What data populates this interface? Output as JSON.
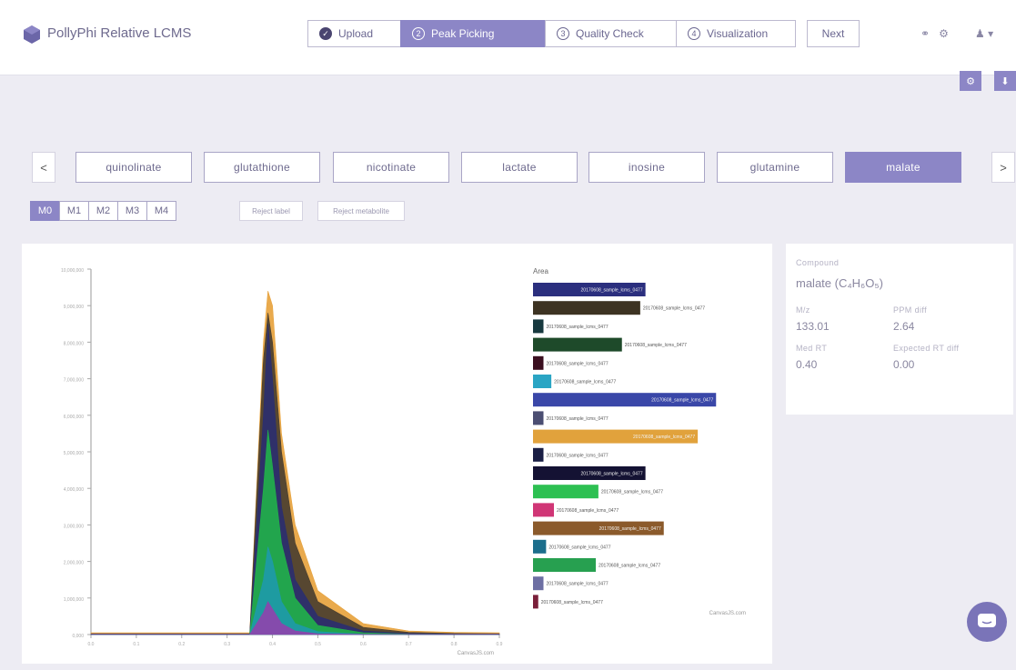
{
  "header": {
    "title": "PollyPhi Relative LCMS",
    "steps": [
      {
        "label": "Upload",
        "marker": "✓"
      },
      {
        "label": "Peak Picking",
        "marker": "2"
      },
      {
        "label": "Quality Check",
        "marker": "3"
      },
      {
        "label": "Visualization",
        "marker": "4"
      }
    ],
    "next_label": "Next",
    "icons": [
      "link-icon",
      "settings-icon",
      "user-icon"
    ]
  },
  "toolbar": {
    "icons": [
      "settings-icon",
      "download-icon"
    ]
  },
  "metabolites": {
    "prev": "<",
    "next": ">",
    "items": [
      "quinolinate",
      "glutathione",
      "nicotinate",
      "lactate",
      "inosine",
      "glutamine",
      "malate"
    ],
    "active": "malate"
  },
  "isotopes": {
    "items": [
      "M0",
      "M1",
      "M2",
      "M3",
      "M4"
    ],
    "active": "M0"
  },
  "actions": {
    "reject_label": "Reject label",
    "reject_metabolite": "Reject metabolite"
  },
  "info": {
    "compound_label": "Compound",
    "compound_name": "malate (C₄H₆O₅)",
    "mz_label": "M/z",
    "mz_value": "133.01",
    "ppm_label": "PPM diff",
    "ppm_value": "2.64",
    "rt_label": "Med RT",
    "rt_value": "0.40",
    "expected_rt_label": "Expected RT diff",
    "expected_rt_value": "0.00"
  },
  "chart_data": [
    {
      "type": "area",
      "description": "Overlaid chromatogram traces for all samples",
      "xlabel": "CanvasJS.com",
      "ylabel": "",
      "x": [
        0,
        0.1,
        0.2,
        0.3,
        0.35,
        0.38,
        0.39,
        0.4,
        0.42,
        0.45,
        0.5,
        0.6,
        0.7,
        0.8,
        0.9
      ],
      "series": [
        {
          "color": "#e7a33e",
          "values": [
            50000,
            50000,
            50000,
            50000,
            50000,
            8000000,
            9400000,
            9000000,
            5500000,
            3000000,
            1200000,
            300000,
            100000,
            60000,
            50000
          ]
        },
        {
          "color": "#4a3f2f",
          "values": [
            20000,
            20000,
            20000,
            20000,
            20000,
            7500000,
            8800000,
            8000000,
            5000000,
            2500000,
            900000,
            200000,
            60000,
            30000,
            20000
          ]
        },
        {
          "color": "#2b2f6e",
          "values": [
            10000,
            10000,
            10000,
            10000,
            10000,
            6000000,
            8500000,
            7000000,
            3500000,
            1500000,
            500000,
            100000,
            30000,
            10000,
            10000
          ]
        },
        {
          "color": "#22b04b",
          "values": [
            5000,
            5000,
            5000,
            5000,
            5000,
            4000000,
            5600000,
            4600000,
            2500000,
            1000000,
            250000,
            50000,
            10000,
            5000,
            5000
          ]
        },
        {
          "color": "#1e9aa8",
          "values": [
            3000,
            3000,
            3000,
            3000,
            3000,
            1500000,
            2400000,
            2000000,
            900000,
            300000,
            80000,
            10000,
            5000,
            3000,
            3000
          ]
        },
        {
          "color": "#8e44ad",
          "values": [
            2000,
            2000,
            2000,
            2000,
            2000,
            600000,
            900000,
            700000,
            300000,
            100000,
            20000,
            5000,
            2000,
            2000,
            2000
          ]
        }
      ],
      "ylim": [
        0,
        10000000
      ]
    },
    {
      "type": "bar",
      "orientation": "horizontal",
      "title": "Area",
      "footer": "CanvasJS.com",
      "sample_label": "20170608_sample_lcms_0477",
      "values": [
        43,
        41,
        4,
        34,
        4,
        7,
        70,
        4,
        63,
        4,
        43,
        25,
        8,
        50,
        5,
        24,
        4,
        2
      ],
      "colors": [
        "#2b2f7e",
        "#3d3322",
        "#17393f",
        "#1e4a2a",
        "#3b0f20",
        "#2aa5c4",
        "#3a47a8",
        "#4b4e72",
        "#e1a23c",
        "#1a1f45",
        "#141233",
        "#2dc052",
        "#d03676",
        "#8b5a2b",
        "#1b6e8c",
        "#27a050",
        "#6d6fa3",
        "#7a1f3a"
      ],
      "xlim": [
        0,
        80
      ]
    }
  ]
}
